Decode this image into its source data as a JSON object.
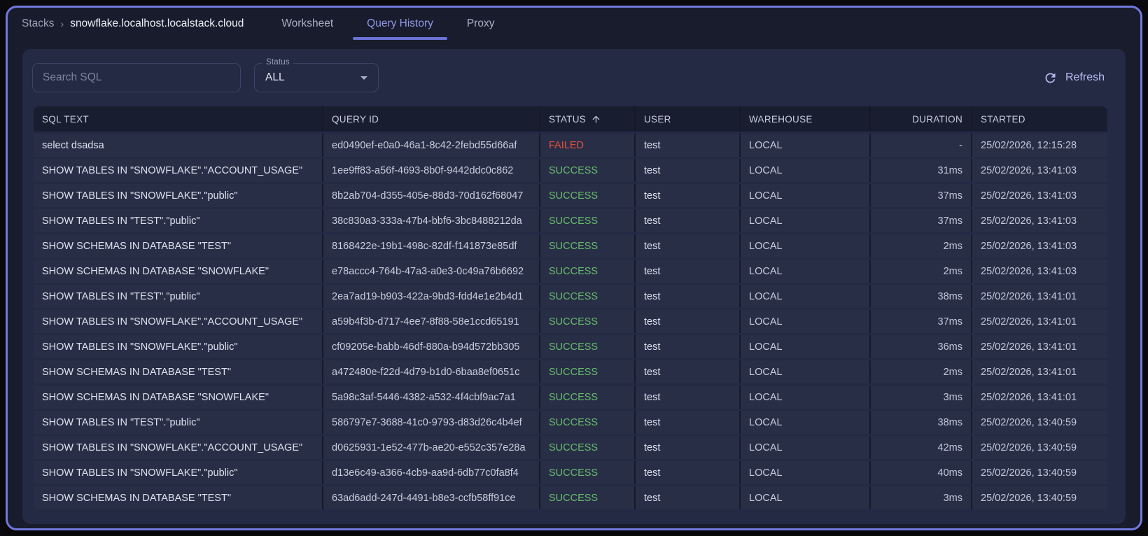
{
  "breadcrumb": {
    "root": "Stacks",
    "separator": "›",
    "current": "snowflake.localhost.localstack.cloud"
  },
  "tabs": [
    {
      "label": "Worksheet",
      "active": false
    },
    {
      "label": "Query History",
      "active": true
    },
    {
      "label": "Proxy",
      "active": false
    }
  ],
  "toolbar": {
    "search_placeholder": "Search SQL",
    "status_label": "Status",
    "status_value": "ALL",
    "refresh_label": "Refresh"
  },
  "table": {
    "columns": [
      {
        "key": "sql",
        "label": "SQL TEXT",
        "align": "left",
        "sorted": false
      },
      {
        "key": "query_id",
        "label": "QUERY ID",
        "align": "left",
        "sorted": false
      },
      {
        "key": "status",
        "label": "STATUS",
        "align": "left",
        "sorted": true
      },
      {
        "key": "user",
        "label": "USER",
        "align": "left",
        "sorted": false
      },
      {
        "key": "warehouse",
        "label": "WAREHOUSE",
        "align": "left",
        "sorted": false
      },
      {
        "key": "duration",
        "label": "DURATION",
        "align": "right",
        "sorted": false
      },
      {
        "key": "started",
        "label": "STARTED",
        "align": "left",
        "sorted": false
      }
    ],
    "status_colors": {
      "SUCCESS": "#66bb6a",
      "FAILED": "#e4503c"
    },
    "rows": [
      {
        "sql": "select dsadsa",
        "query_id": "ed0490ef-e0a0-46a1-8c42-2febd55d66af",
        "status": "FAILED",
        "user": "test",
        "warehouse": "LOCAL",
        "duration": "-",
        "started": "25/02/2026, 12:15:28"
      },
      {
        "sql": "SHOW TABLES IN \"SNOWFLAKE\".\"ACCOUNT_USAGE\"",
        "query_id": "1ee9ff83-a56f-4693-8b0f-9442ddc0c862",
        "status": "SUCCESS",
        "user": "test",
        "warehouse": "LOCAL",
        "duration": "31ms",
        "started": "25/02/2026, 13:41:03"
      },
      {
        "sql": "SHOW TABLES IN \"SNOWFLAKE\".\"public\"",
        "query_id": "8b2ab704-d355-405e-88d3-70d162f68047",
        "status": "SUCCESS",
        "user": "test",
        "warehouse": "LOCAL",
        "duration": "37ms",
        "started": "25/02/2026, 13:41:03"
      },
      {
        "sql": "SHOW TABLES IN \"TEST\".\"public\"",
        "query_id": "38c830a3-333a-47b4-bbf6-3bc8488212da",
        "status": "SUCCESS",
        "user": "test",
        "warehouse": "LOCAL",
        "duration": "37ms",
        "started": "25/02/2026, 13:41:03"
      },
      {
        "sql": "SHOW SCHEMAS IN DATABASE \"TEST\"",
        "query_id": "8168422e-19b1-498c-82df-f141873e85df",
        "status": "SUCCESS",
        "user": "test",
        "warehouse": "LOCAL",
        "duration": "2ms",
        "started": "25/02/2026, 13:41:03"
      },
      {
        "sql": "SHOW SCHEMAS IN DATABASE \"SNOWFLAKE\"",
        "query_id": "e78accc4-764b-47a3-a0e3-0c49a76b6692",
        "status": "SUCCESS",
        "user": "test",
        "warehouse": "LOCAL",
        "duration": "2ms",
        "started": "25/02/2026, 13:41:03"
      },
      {
        "sql": "SHOW TABLES IN \"TEST\".\"public\"",
        "query_id": "2ea7ad19-b903-422a-9bd3-fdd4e1e2b4d1",
        "status": "SUCCESS",
        "user": "test",
        "warehouse": "LOCAL",
        "duration": "38ms",
        "started": "25/02/2026, 13:41:01"
      },
      {
        "sql": "SHOW TABLES IN \"SNOWFLAKE\".\"ACCOUNT_USAGE\"",
        "query_id": "a59b4f3b-d717-4ee7-8f88-58e1ccd65191",
        "status": "SUCCESS",
        "user": "test",
        "warehouse": "LOCAL",
        "duration": "37ms",
        "started": "25/02/2026, 13:41:01"
      },
      {
        "sql": "SHOW TABLES IN \"SNOWFLAKE\".\"public\"",
        "query_id": "cf09205e-babb-46df-880a-b94d572bb305",
        "status": "SUCCESS",
        "user": "test",
        "warehouse": "LOCAL",
        "duration": "36ms",
        "started": "25/02/2026, 13:41:01"
      },
      {
        "sql": "SHOW SCHEMAS IN DATABASE \"TEST\"",
        "query_id": "a472480e-f22d-4d79-b1d0-6baa8ef0651c",
        "status": "SUCCESS",
        "user": "test",
        "warehouse": "LOCAL",
        "duration": "2ms",
        "started": "25/02/2026, 13:41:01"
      },
      {
        "sql": "SHOW SCHEMAS IN DATABASE \"SNOWFLAKE\"",
        "query_id": "5a98c3af-5446-4382-a532-4f4cbf9ac7a1",
        "status": "SUCCESS",
        "user": "test",
        "warehouse": "LOCAL",
        "duration": "3ms",
        "started": "25/02/2026, 13:41:01"
      },
      {
        "sql": "SHOW TABLES IN \"TEST\".\"public\"",
        "query_id": "586797e7-3688-41c0-9793-d83d26c4b4ef",
        "status": "SUCCESS",
        "user": "test",
        "warehouse": "LOCAL",
        "duration": "38ms",
        "started": "25/02/2026, 13:40:59"
      },
      {
        "sql": "SHOW TABLES IN \"SNOWFLAKE\".\"ACCOUNT_USAGE\"",
        "query_id": "d0625931-1e52-477b-ae20-e552c357e28a",
        "status": "SUCCESS",
        "user": "test",
        "warehouse": "LOCAL",
        "duration": "42ms",
        "started": "25/02/2026, 13:40:59"
      },
      {
        "sql": "SHOW TABLES IN \"SNOWFLAKE\".\"public\"",
        "query_id": "d13e6c49-a366-4cb9-aa9d-6db77c0fa8f4",
        "status": "SUCCESS",
        "user": "test",
        "warehouse": "LOCAL",
        "duration": "40ms",
        "started": "25/02/2026, 13:40:59"
      },
      {
        "sql": "SHOW SCHEMAS IN DATABASE \"TEST\"",
        "query_id": "63ad6add-247d-4491-b8e3-ccfb58ff91ce",
        "status": "SUCCESS",
        "user": "test",
        "warehouse": "LOCAL",
        "duration": "3ms",
        "started": "25/02/2026, 13:40:59"
      }
    ]
  },
  "colors": {
    "window_border": "#7178dc",
    "window_bg": "#191c2c",
    "panel_bg": "#242944",
    "row_bg": "#292e47",
    "header_bg": "#191d30",
    "active_tab": "#9097e8",
    "success": "#66bb6a",
    "failed": "#e4503c"
  }
}
